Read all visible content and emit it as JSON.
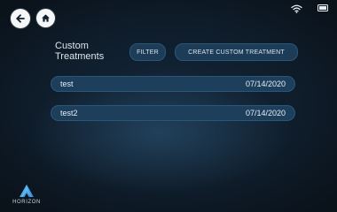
{
  "header": {
    "back_icon": "arrow-left-icon",
    "home_icon": "home-icon"
  },
  "status": {
    "wifi_icon": "wifi-icon",
    "battery_icon": "battery-icon"
  },
  "page": {
    "title_line1": "Custom",
    "title_line2": "Treatments"
  },
  "actions": {
    "filter_label": "FILTER",
    "create_label": "CREATE CUSTOM TREATMENT"
  },
  "treatments": [
    {
      "name": "test",
      "date": "07/14/2020"
    },
    {
      "name": "test2",
      "date": "07/14/2020"
    }
  ],
  "brand": {
    "name": "HORIZON"
  },
  "colors": {
    "background": "#0f1d2b",
    "pill": "#1d3f5c",
    "text": "#e6edf3"
  }
}
